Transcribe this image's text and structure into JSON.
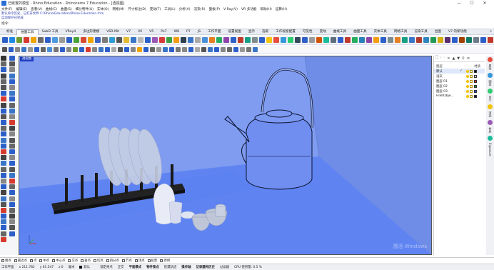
{
  "window": {
    "title": "已嵌置的模型 - Rhino.Education - Rhinoceros 7 Education - [透视图]",
    "minimize": "—",
    "maximize": "☐",
    "close": "✕"
  },
  "menu": [
    "文件(F)",
    "编辑(E)",
    "查看(V)",
    "曲线(C)",
    "曲面(S)",
    "细分物件(U)",
    "实体(O)",
    "网格(M)",
    "尺寸标注(D)",
    "变动(T)",
    "工具(L)",
    "分析(A)",
    "渲染(R)",
    "面板(P)",
    "V-Ray(V)",
    "VR 多功能",
    "帮助(H)",
    "运算(H)"
  ],
  "command": {
    "history_1": "默认命令历史，已打开文件 C:\\Rhino\\Education\\Rhino.Education.rhm",
    "history_2": "自动保存已完成",
    "prompt": "指令:",
    "input_value": ""
  },
  "tabs": [
    "标准",
    "曲面工具",
    "SubD 工具",
    "VRay4",
    "多边形建模",
    "VSR-Mit",
    "V7",
    "V6",
    "V5",
    "Pe7",
    "W8",
    "P7",
    "JS",
    "工作平面",
    "设置视图",
    "显示",
    "选取",
    "工作视窗配置",
    "可见性",
    "变动",
    "曲线工具",
    "曲面工具",
    "实体工具",
    "网格工具",
    "渲染工具",
    "出图",
    "V7 的新功能"
  ],
  "tab_active_index": 1,
  "tab_more": "»",
  "toolbar1_colors": [
    "#2d5fc9",
    "#1e88e5",
    "#6d9c2c",
    "#d73b2f",
    "#f0a500",
    "#6a6a6a",
    "#2d5fc9",
    "#4c9be0",
    "#9a9a9a",
    "#2d5fc9",
    "#48a23a",
    "#d64a2d",
    "#f0a500",
    "#3b64c4",
    "#7a7a7a",
    "#2f9ad3",
    "#555555",
    "#e2bb32",
    "#3a76c7",
    "#b9b9b9",
    "#2d5fc9",
    "#9b59b6",
    "#d63b3b",
    "#3aa040",
    "#f39c12",
    "#2c3e50",
    "#3a76c7",
    "#aaaaaa",
    "#4a90d9",
    "#e67e22",
    "#27ae60",
    "#8e44ad",
    "#2d5fc9",
    "#c0392b",
    "#16a085",
    "#7f8c8d",
    "#2d5fc9",
    "#f1c40f",
    "#e74c3c",
    "#3498db",
    "#2ecc71",
    "#34495e",
    "#2d5fc9",
    "#9a9a9a",
    "#d35400",
    "#1abc9c",
    "#5d6d7e",
    "#2d5fc9",
    "#c0392b",
    "#27ae60",
    "#2980b9",
    "#8e44ad",
    "#f39c12",
    "#2d5fc9",
    "#7f8c8d",
    "#e67e22",
    "#16a085",
    "#3a76c7",
    "#b03a2e",
    "#2e86c1",
    "#229954",
    "#d4ac0d",
    "#5b2c6f",
    "#2d5fc9",
    "#a04000",
    "#117a65",
    "#6c7a89",
    "#2d5fc9",
    "#c0392b",
    "#1f618d"
  ],
  "toolbar2_colors": [
    "#555",
    "#2d5fc9",
    "#888",
    "#3a76c7",
    "#999",
    "#2d5fc9",
    "#666",
    "#4a90d9",
    "#777",
    "#2d5fc9",
    "#888",
    "#6d9c2c",
    "#2d5fc9",
    "#d73b2f",
    "#888",
    "#3a76c7",
    "#2d5fc9",
    "#aaa",
    "#555",
    "#2d5fc9",
    "#888",
    "#f0a500",
    "#2d5fc9",
    "#666",
    "#999",
    "#3a76c7",
    "#2d5fc9",
    "#777",
    "#888",
    "#2d5fc9",
    "#aaa",
    "#555",
    "#3a76c7",
    "#2d5fc9",
    "#888",
    "#6a6a6a",
    "#2d5fc9",
    "#999",
    "#777",
    "#3a76c7"
  ],
  "left_tool_colors": [
    "#333",
    "#2d5fc9",
    "#666",
    "#555",
    "#2d5fc9",
    "#888",
    "#444",
    "#3a76c7",
    "#666",
    "#2d5fc9",
    "#555",
    "#888",
    "#2d5fc9",
    "#3a76c7",
    "#d73b2f",
    "#2d5fc9",
    "#444",
    "#666",
    "#2d5fc9",
    "#3a76c7",
    "#555",
    "#888",
    "#2d5fc9",
    "#d73b2f",
    "#666",
    "#444",
    "#2d5fc9",
    "#888",
    "#3a76c7",
    "#555",
    "#2d5fc9",
    "#666",
    "#d73b2f",
    "#2d5fc9",
    "#444",
    "#888",
    "#3a76c7",
    "#2d5fc9",
    "#666",
    "#555",
    "#2d5fc9",
    "#3a76c7",
    "#888",
    "#d73b2f",
    "#2d5fc9",
    "#666",
    "#444",
    "#2d5fc9",
    "#3a76c7",
    "#888",
    "#555",
    "#2d5fc9",
    "#d73b2f",
    "#666",
    "#2d5fc9",
    "#444",
    "#3a76c7",
    "#888",
    "#2d5fc9",
    "#555",
    "#666",
    "#2d5fc9",
    "#d73b2f"
  ],
  "viewport": {
    "label": "透视图",
    "watermark": "激活 Windows"
  },
  "panel": {
    "tool_icons": [
      "🗋",
      "🗁",
      "✕",
      "▲",
      "▼",
      "⚲",
      "≡"
    ],
    "col_name": "图层",
    "col_material": "材质",
    "layers": [
      {
        "name": "默认",
        "current": "✓",
        "color": "#111111"
      },
      {
        "name": "浅灰",
        "current": "",
        "color": "#c8c8c8"
      },
      {
        "name": "图层 01",
        "current": "",
        "color": "#d92b2b"
      },
      {
        "name": "图层 02",
        "current": "",
        "color": "#2d8f2d"
      },
      {
        "name": "图层 03",
        "current": "",
        "color": "#2b4fd9"
      },
      {
        "name": "FilletObje...",
        "current": "",
        "color": "#111111"
      }
    ]
  },
  "right_tabs": [
    "属性",
    "图层",
    "显示",
    "渲染",
    "材质",
    "Exposure"
  ],
  "osnaps": [
    {
      "label": "端点",
      "on": true
    },
    {
      "label": "最近点",
      "on": false
    },
    {
      "label": "点",
      "on": true
    },
    {
      "label": "中点",
      "on": false
    },
    {
      "label": "中心点",
      "on": true
    },
    {
      "label": "交点",
      "on": false
    },
    {
      "label": "垂点",
      "on": false
    },
    {
      "label": "切点",
      "on": false
    },
    {
      "label": "四分点",
      "on": false
    },
    {
      "label": "节点",
      "on": false
    },
    {
      "label": "顶点",
      "on": false
    },
    {
      "label": "投影",
      "on": false
    },
    {
      "label": "停用",
      "on": false
    }
  ],
  "status": {
    "cplane": "工作平面",
    "x": "x 211.782",
    "y": "y 61.547",
    "z": "z 0",
    "units": "毫米",
    "layer": "默认",
    "grid_snap": "锁定格点",
    "ortho": "正交",
    "planar": "平面模式",
    "osnap": "物件锁点",
    "smarttrack": "智慧轨迹",
    "gumball": "操作轴",
    "history": "记录建构历史",
    "filter": "过滤器",
    "cpu": "CPU 使用量: 0.5 %"
  }
}
